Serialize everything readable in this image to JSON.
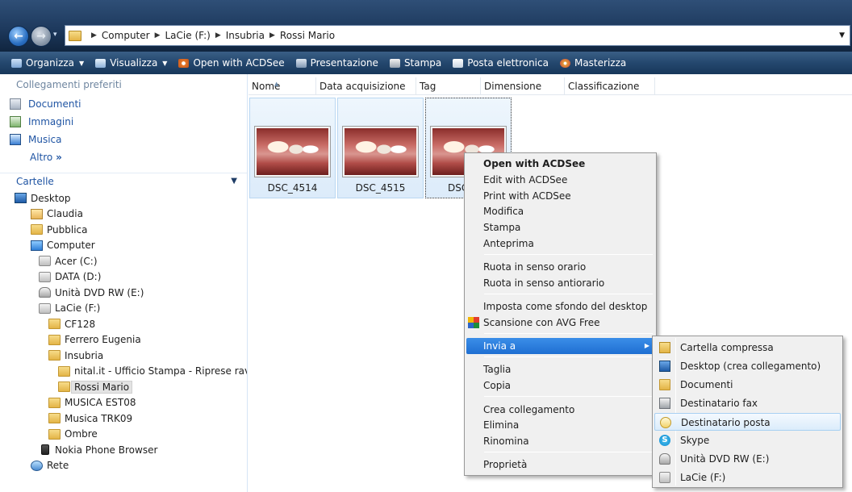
{
  "address": {
    "crumbs": [
      "Computer",
      "LaCie (F:)",
      "Insubria",
      "Rossi Mario"
    ]
  },
  "toolbar": {
    "items": [
      "Organizza",
      "Visualizza",
      "Open with ACDSee",
      "Presentazione",
      "Stampa",
      "Posta elettronica",
      "Masterizza"
    ]
  },
  "nav": {
    "favorites_header": "Collegamenti preferiti",
    "favorites": [
      "Documenti",
      "Immagini",
      "Musica"
    ],
    "more": "Altro",
    "folders_header": "Cartelle",
    "tree": [
      "Desktop",
      "Claudia",
      "Pubblica",
      "Computer",
      "Acer (C:)",
      "DATA (D:)",
      "Unità DVD RW (E:)",
      "LaCie (F:)",
      "CF128",
      "Ferrero Eugenia",
      "Insubria",
      "nital.it - Ufficio Stampa - Riprese ravvi",
      "Rossi Mario",
      "MUSICA EST08",
      "Musica TRK09",
      "Ombre",
      "Nokia Phone Browser",
      "Rete"
    ]
  },
  "columns": [
    "Nome",
    "Data acquisizione",
    "Tag",
    "Dimensione",
    "Classificazione"
  ],
  "files": [
    "DSC_4514",
    "DSC_4515",
    "DSC"
  ],
  "context_menu": {
    "items": [
      "Open with ACDSee",
      "Edit with ACDSee",
      "Print with ACDSee",
      "Modifica",
      "Stampa",
      "Anteprima",
      "Ruota in senso orario",
      "Ruota in senso antiorario",
      "Imposta come sfondo del desktop",
      "Scansione con AVG Free",
      "Invia a",
      "Taglia",
      "Copia",
      "Crea collegamento",
      "Elimina",
      "Rinomina",
      "Proprietà"
    ]
  },
  "send_to": {
    "items": [
      "Cartella compressa",
      "Desktop (crea collegamento)",
      "Documenti",
      "Destinatario fax",
      "Destinatario posta",
      "Skype",
      "Unità DVD RW (E:)",
      "LaCie (F:)"
    ]
  }
}
